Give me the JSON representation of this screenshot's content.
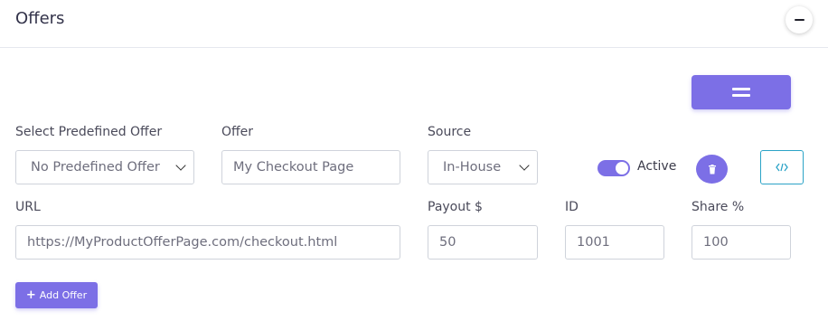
{
  "panel": {
    "title": "Offers"
  },
  "fields": {
    "predefined": {
      "label": "Select Predefined Offer",
      "value": "No Predefined Offer"
    },
    "offer": {
      "label": "Offer",
      "placeholder": "My Checkout Page"
    },
    "source": {
      "label": "Source",
      "value": "In-House"
    },
    "url": {
      "label": "URL",
      "placeholder": "https://MyProductOfferPage.com/checkout.html"
    },
    "payout": {
      "label": "Payout $",
      "placeholder": "50"
    },
    "id": {
      "label": "ID",
      "placeholder": "1001"
    },
    "share": {
      "label": "Share %",
      "placeholder": "100"
    }
  },
  "toggle": {
    "label": "Active",
    "on": true
  },
  "buttons": {
    "add_offer": "Add Offer"
  },
  "icons": {
    "collapse": "minus-icon",
    "drag": "drag-handle-icon",
    "delete": "trash-icon",
    "code": "code-icon",
    "add": "plus-icon"
  },
  "colors": {
    "accent": "#7c6fe6",
    "info": "#2ba3c7"
  }
}
